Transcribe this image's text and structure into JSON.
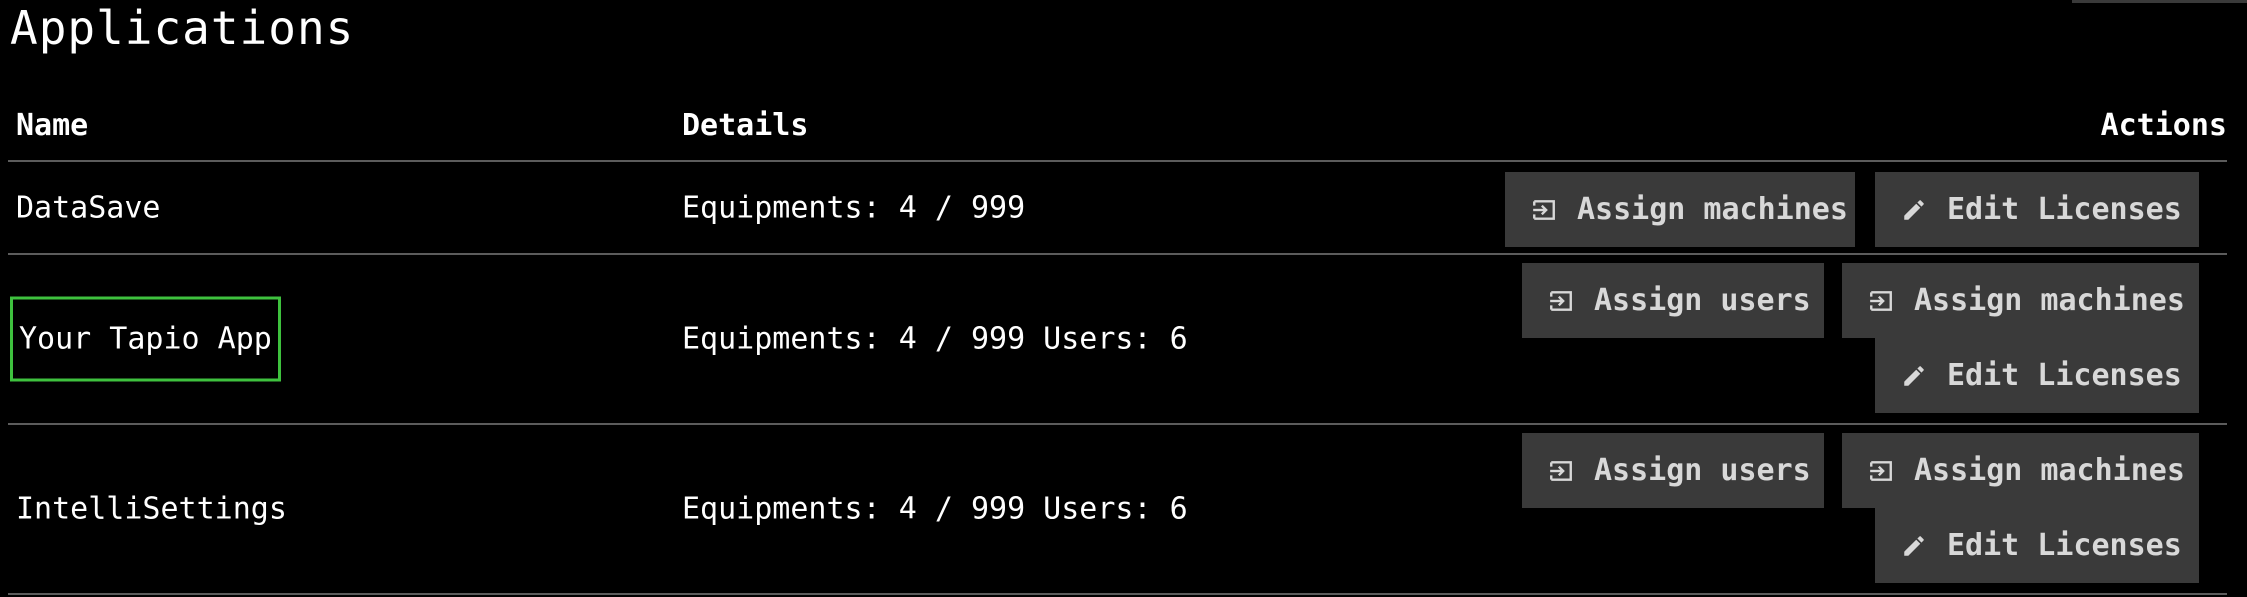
{
  "page": {
    "title": "Applications"
  },
  "table": {
    "headers": {
      "name": "Name",
      "details": "Details",
      "actions": "Actions"
    },
    "rows": [
      {
        "name": "DataSave",
        "details": "Equipments: 4 / 999",
        "details_users": "",
        "actions": [
          "Assign machines",
          "Edit Licenses"
        ]
      },
      {
        "name": "Your Tapio App",
        "details": "Equipments: 4 / 999",
        "details_users": "Users: 6",
        "actions": [
          "Assign users",
          "Assign machines",
          "Edit Licenses"
        ],
        "focused": true
      },
      {
        "name": "IntelliSettings",
        "details": "Equipments: 4 / 999",
        "details_users": "Users: 6",
        "actions": [
          "Assign users",
          "Assign machines",
          "Edit Licenses"
        ]
      }
    ]
  },
  "icons": {
    "assign": "login-arrow-icon",
    "edit": "pencil-icon"
  },
  "colors": {
    "background": "#000000",
    "button_bg": "#3a3a3a",
    "button_text": "#d8d8d8",
    "focus_outline": "#3ec13e",
    "divider": "#5c5c5c"
  }
}
